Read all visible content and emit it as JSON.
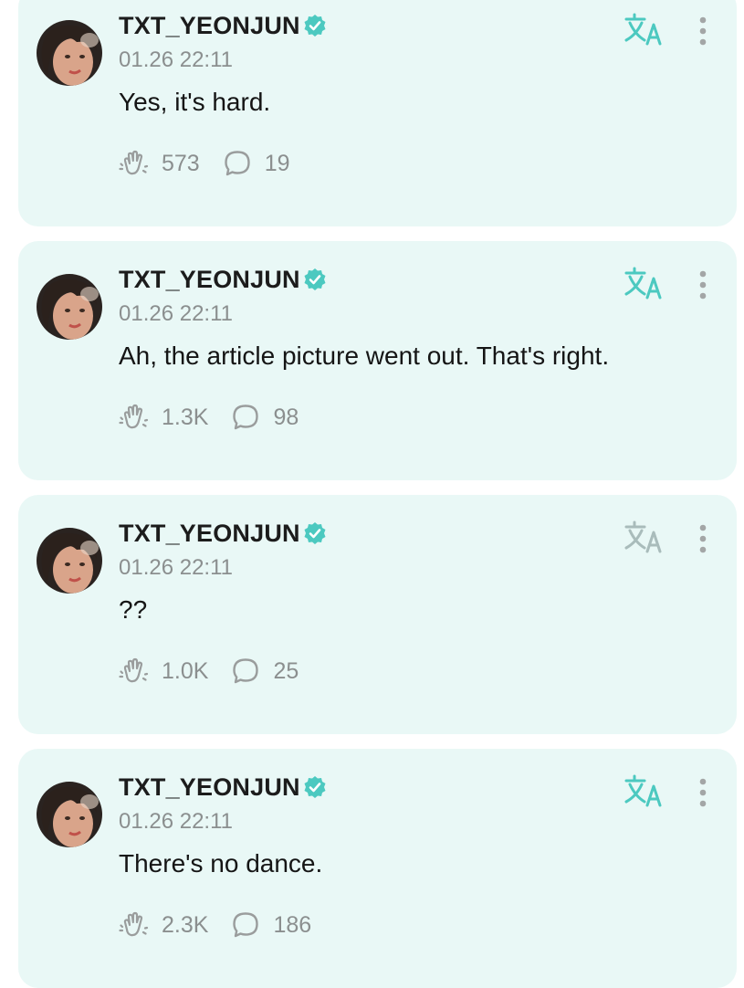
{
  "posts": [
    {
      "author": "TXT_YEONJUN",
      "time": "01.26 22:11",
      "text": "Yes, it's hard.",
      "likes": "573",
      "comments": "19",
      "translate_active": true
    },
    {
      "author": "TXT_YEONJUN",
      "time": "01.26 22:11",
      "text": "Ah, the article picture went out. That's right.",
      "likes": "1.3K",
      "comments": "98",
      "translate_active": true
    },
    {
      "author": "TXT_YEONJUN",
      "time": "01.26 22:11",
      "text": "??",
      "likes": "1.0K",
      "comments": "25",
      "translate_active": false
    },
    {
      "author": "TXT_YEONJUN",
      "time": "01.26 22:11",
      "text": "There's no dance.",
      "likes": "2.3K",
      "comments": "186",
      "translate_active": true
    }
  ],
  "icons": {
    "verified": "verified-badge-icon",
    "translate": "translate-icon",
    "more": "more-vertical-icon",
    "like": "clap-hand-icon",
    "comment": "speech-bubble-icon"
  },
  "colors": {
    "card_background": "#e9f8f6",
    "accent_teal": "#4cc9c0",
    "translate_inactive": "#a9bcbb",
    "text_primary": "#151515",
    "text_secondary": "#8b8f8f",
    "icon_gray": "#9a9d9d"
  }
}
